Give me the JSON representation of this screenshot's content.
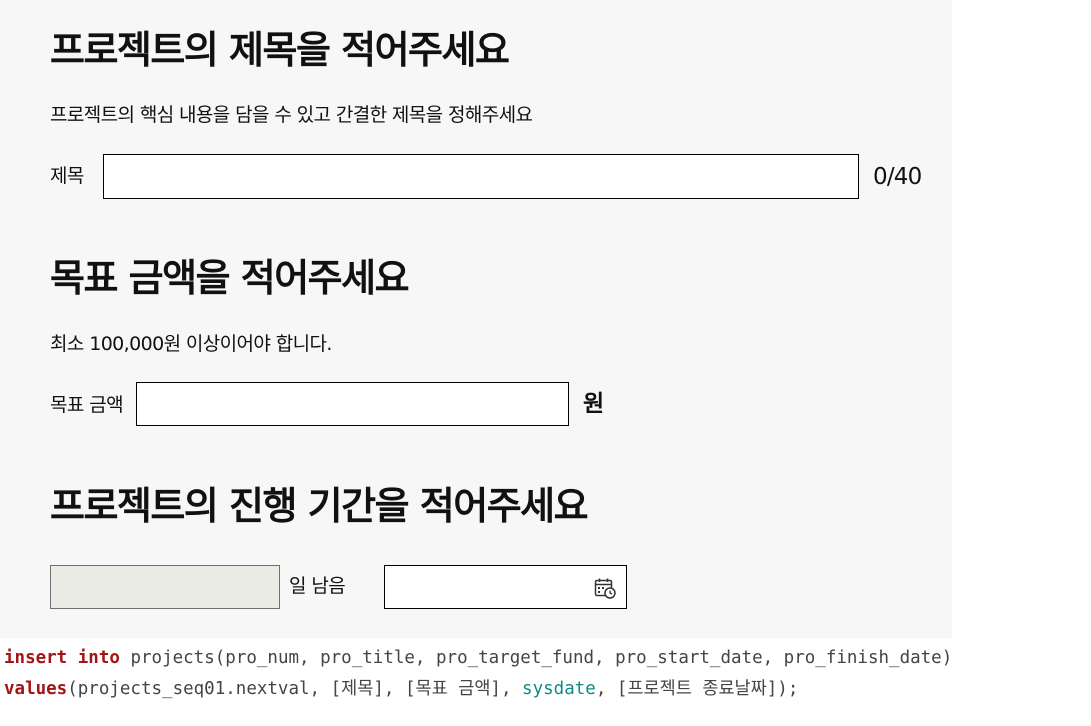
{
  "title_section": {
    "heading": "프로젝트의 제목을 적어주세요",
    "description": "프로젝트의 핵심 내용을 담을 수 있고 간결한 제목을 정해주세요",
    "field_label": "제목",
    "field_value": "",
    "char_count": "0/40"
  },
  "goal_section": {
    "heading": "목표 금액을 적어주세요",
    "description": "최소 100,000원 이상이어야 합니다.",
    "field_label": "목표 금액",
    "field_value": "",
    "unit": "원"
  },
  "period_section": {
    "heading": "프로젝트의 진행 기간을 적어주세요",
    "days_value": "",
    "days_suffix": "일 남음",
    "date_value": "",
    "date_icon": "calendar-icon"
  },
  "sql": {
    "line1": {
      "kw1": "insert",
      "kw2": "into",
      "rest": " projects(pro_num, pro_title, pro_target_fund, pro_start_date, pro_finish_date)"
    },
    "line2": {
      "kw": "values",
      "part1": "(projects_seq01.nextval, [제목], [목표 금액], ",
      "fn": "sysdate",
      "part2": ", [프로젝트 종료날짜]);"
    }
  },
  "colors": {
    "panel_bg": "#f7f7f8",
    "keyword": "#a31515",
    "function": "#0f8a8a",
    "disabled_field": "#ebebe6"
  }
}
